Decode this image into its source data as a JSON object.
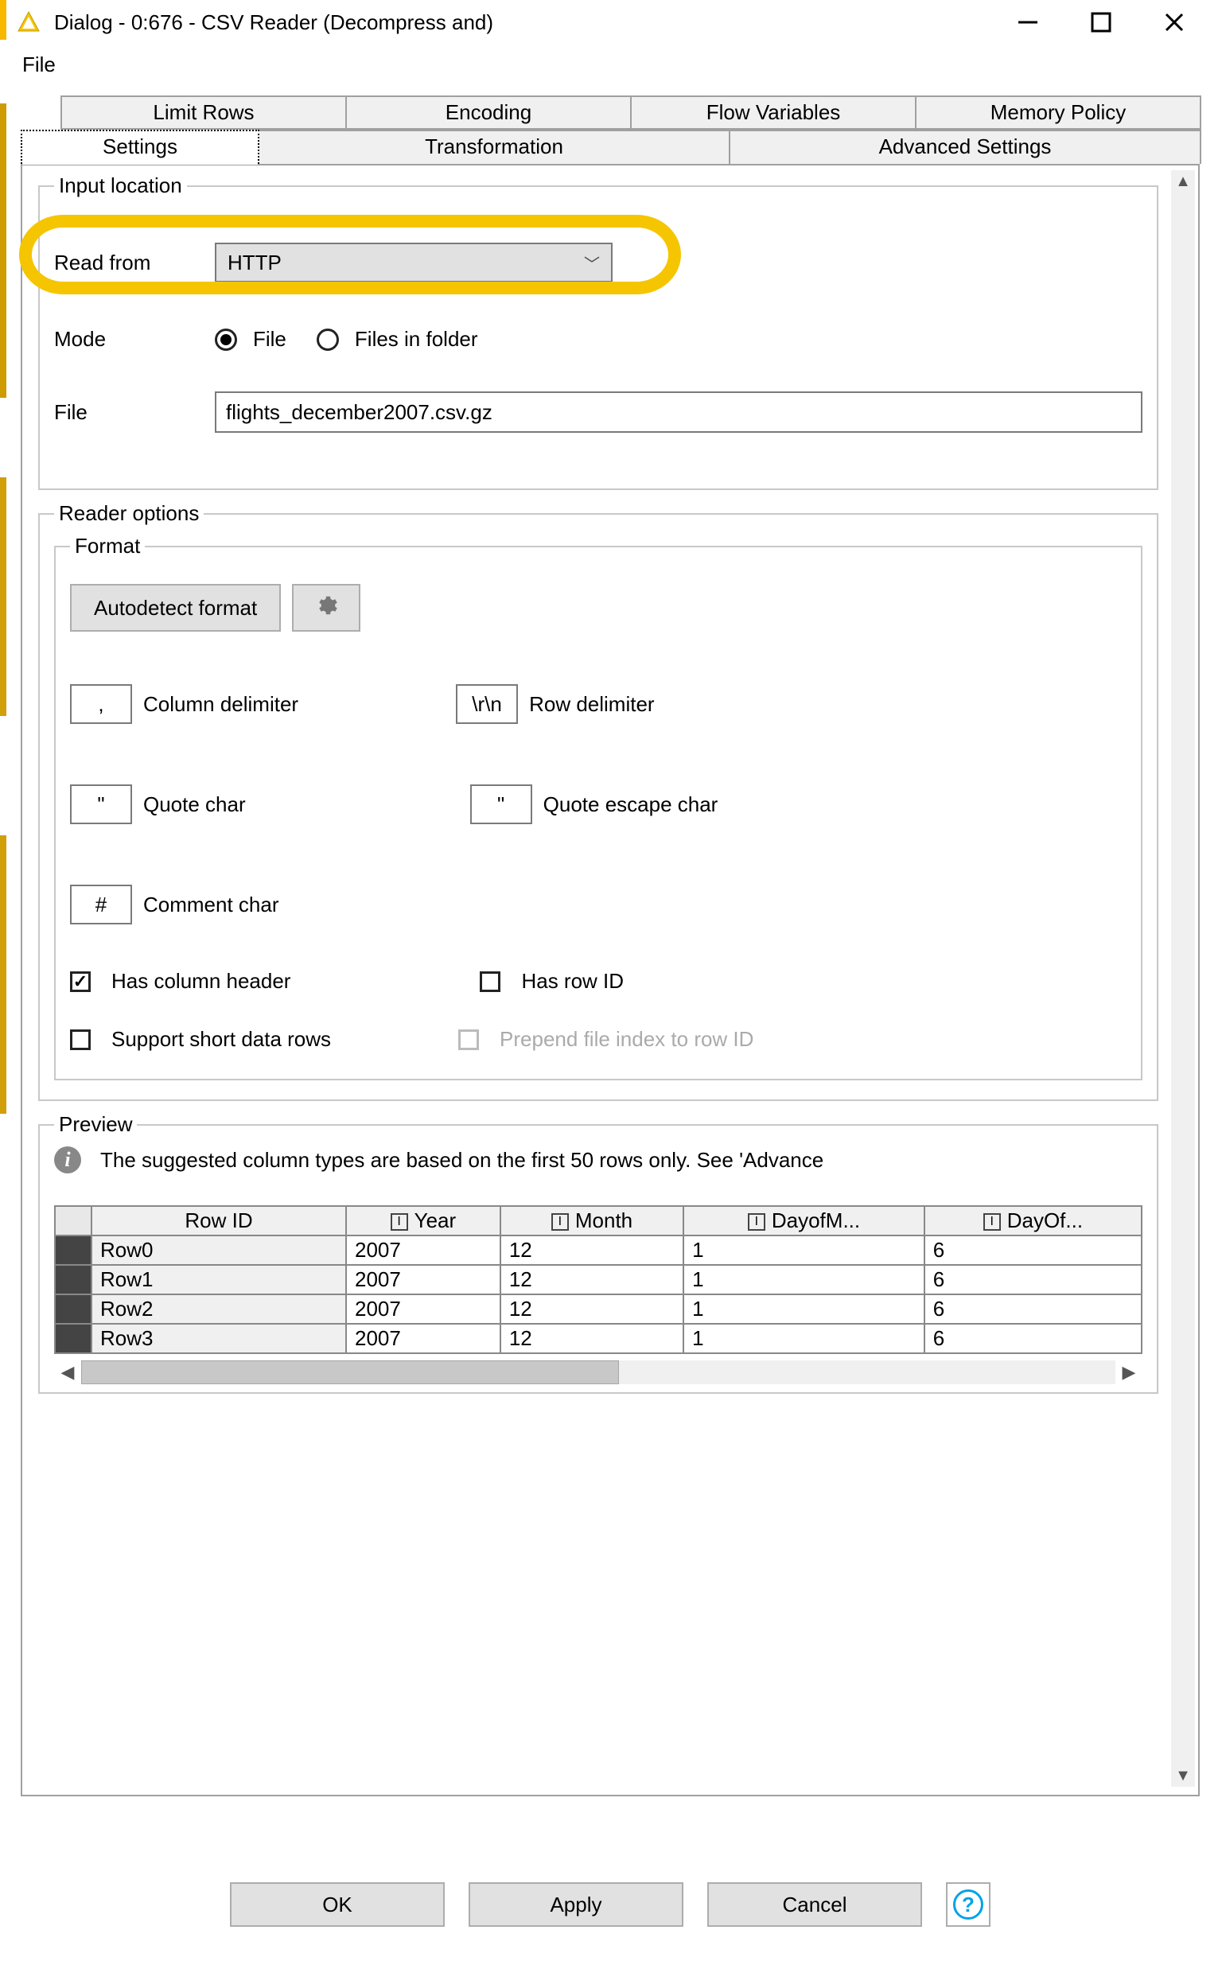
{
  "window": {
    "title": "Dialog - 0:676 - CSV Reader (Decompress and)"
  },
  "menu": {
    "file": "File"
  },
  "tabs": {
    "row1": [
      "Limit Rows",
      "Encoding",
      "Flow Variables",
      "Memory Policy"
    ],
    "row2": [
      "Settings",
      "Transformation",
      "Advanced Settings"
    ],
    "selected": "Settings"
  },
  "input_location": {
    "legend": "Input location",
    "read_from_label": "Read from",
    "read_from_value": "HTTP",
    "mode_label": "Mode",
    "mode_file": "File",
    "mode_folder": "Files in folder",
    "file_label": "File",
    "file_value": "flights_december2007.csv.gz"
  },
  "reader_options": {
    "legend": "Reader options",
    "format": {
      "legend": "Format",
      "autodetect": "Autodetect format",
      "col_delim_value": ",",
      "col_delim_label": "Column delimiter",
      "row_delim_value": "\\r\\n",
      "row_delim_label": "Row delimiter",
      "quote_value": "\"",
      "quote_label": "Quote char",
      "escape_value": "\"",
      "escape_label": "Quote escape char",
      "comment_value": "#",
      "comment_label": "Comment char",
      "has_header": "Has column header",
      "has_rowid": "Has row ID",
      "short_rows": "Support short data rows",
      "prepend_idx": "Prepend file index to row ID"
    }
  },
  "preview": {
    "legend": "Preview",
    "note": "The suggested column types are based on the first 50 rows only. See 'Advance",
    "columns": [
      "Row ID",
      "Year",
      "Month",
      "DayofM...",
      "DayOf..."
    ],
    "rows": [
      {
        "id": "Row0",
        "vals": [
          "2007",
          "12",
          "1",
          "6"
        ]
      },
      {
        "id": "Row1",
        "vals": [
          "2007",
          "12",
          "1",
          "6"
        ]
      },
      {
        "id": "Row2",
        "vals": [
          "2007",
          "12",
          "1",
          "6"
        ]
      },
      {
        "id": "Row3",
        "vals": [
          "2007",
          "12",
          "1",
          "6"
        ]
      }
    ]
  },
  "footer": {
    "ok": "OK",
    "apply": "Apply",
    "cancel": "Cancel"
  }
}
